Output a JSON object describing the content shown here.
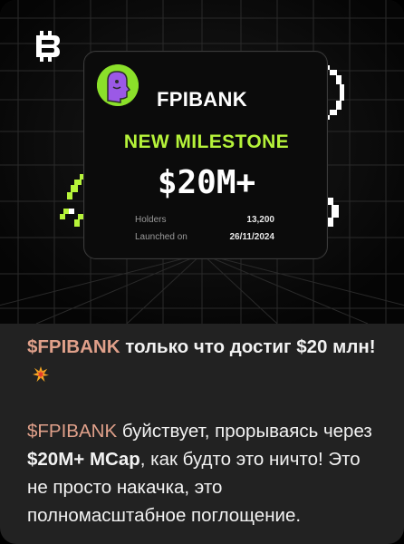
{
  "banner": {
    "brand": "FPIBANK",
    "milestone_label": "NEW MILESTONE",
    "amount": "$20M+",
    "stats": [
      {
        "label": "Holders",
        "value": "13,200"
      },
      {
        "label": "Launched on",
        "value": "26/11/2024"
      }
    ],
    "colors": {
      "accent": "#B6F33A",
      "avatar_bg": "#8BE02A",
      "avatar_face": "#9B59E6"
    },
    "logo_icon": "bitcoin-like-logo-icon"
  },
  "message": {
    "line1_ticker": "$FPIBANK",
    "line1_text": " только что достиг $20 млн!",
    "line1_emoji": "collision-emoji",
    "p2_ticker": "$FPIBANK",
    "p2_text_a": " буйствует, прорываясь через ",
    "p2_bold": "$20M+ MCap",
    "p2_text_b": ", как будто это ничто! Это не просто накачка, это полномасштабное поглощение.",
    "ticker_color": "#E0A08A"
  }
}
